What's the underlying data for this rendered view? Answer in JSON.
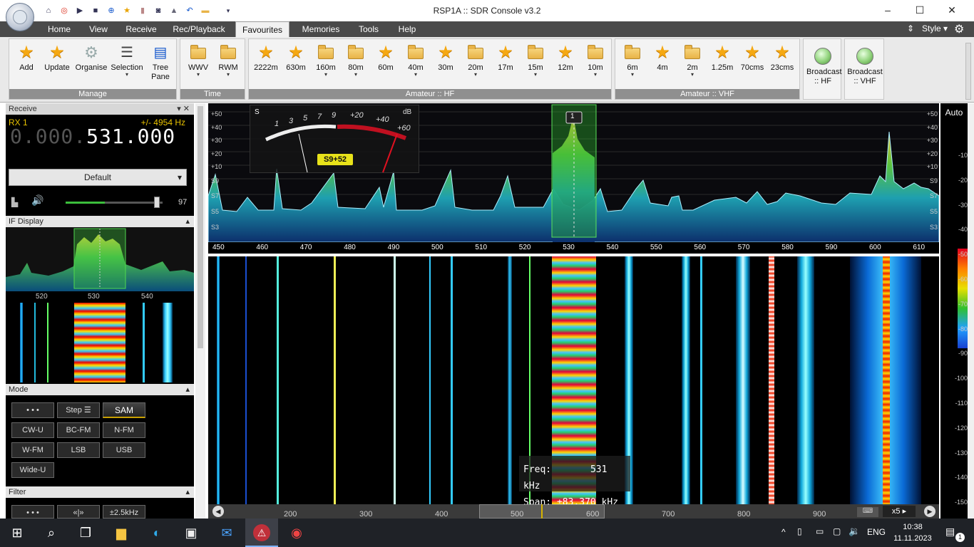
{
  "window": {
    "title": "RSP1A :: SDR Console v3.2",
    "controls": [
      "–",
      "☐",
      "✕"
    ]
  },
  "ribbon": {
    "tabs": [
      "Home",
      "View",
      "Receive",
      "Rec/Playback",
      "Favourites",
      "Memories",
      "Tools",
      "Help"
    ],
    "active_tab": "Favourites",
    "style_label": "Style",
    "groups": {
      "manage": {
        "label": "Manage",
        "buttons": [
          "Add",
          "Update",
          "Organise",
          "Selection",
          "Tree Pane"
        ]
      },
      "time": {
        "label": "Time",
        "buttons": [
          "WWV",
          "RWM"
        ]
      },
      "amateur_hf": {
        "label": "Amateur :: HF",
        "buttons": [
          "2222m",
          "630m",
          "160m",
          "80m",
          "60m",
          "40m",
          "30m",
          "20m",
          "17m",
          "15m",
          "12m",
          "10m"
        ]
      },
      "amateur_vhf": {
        "label": "Amateur :: VHF",
        "buttons": [
          "6m",
          "4m",
          "2m",
          "1.25m",
          "70cms",
          "23cms"
        ]
      },
      "broadcast": [
        "Broadcast :: HF",
        "Broadcast :: VHF"
      ]
    }
  },
  "receive_panel": {
    "header": "Receive",
    "rx_label": "RX 1",
    "offset": "+/- 4954 Hz",
    "freq_dim": "0.000.",
    "freq_main": "531.000",
    "preset": "Default",
    "volume": 97,
    "volume_label": "97"
  },
  "if_display": {
    "header": "IF Display",
    "ticks": [
      "520",
      "530",
      "540"
    ]
  },
  "mode_panel": {
    "header": "Mode",
    "buttons": [
      "• • •",
      "Step ☰",
      "SAM",
      "CW-U",
      "BC-FM",
      "N-FM",
      "W-FM",
      "LSB",
      "USB",
      "Wide-U"
    ],
    "selected": "SAM"
  },
  "filter_panel": {
    "header": "Filter",
    "buttons": [
      "• • •",
      "«|»",
      "±2.5kHz"
    ]
  },
  "spectrum": {
    "left_scale": [
      "+50",
      "+40",
      "+30",
      "+20",
      "+10",
      "S9",
      "S7",
      "S5",
      "S3"
    ],
    "right_scale": [
      "+50",
      "+40",
      "+30",
      "+20",
      "+10",
      "S9",
      "S7",
      "S5",
      "S3"
    ],
    "smeter_labels": [
      "S",
      "1",
      "3",
      "5",
      "7",
      "9",
      "+20",
      "+40",
      "+60",
      "dB"
    ],
    "smeter_reading": "S9+52",
    "marker": "1",
    "freq_ticks": [
      "450",
      "460",
      "470",
      "480",
      "490",
      "500",
      "510",
      "520",
      "530",
      "540",
      "550",
      "560",
      "570",
      "580",
      "590",
      "600",
      "610"
    ]
  },
  "waterfall": {
    "info_freq_label": "Freq:",
    "info_freq_value": "531 kHz",
    "info_span_label": "Span:",
    "info_span_value": "±83.370 kHz",
    "overview_ticks": [
      "200",
      "300",
      "400",
      "500",
      "600",
      "700",
      "800",
      "900"
    ],
    "zoom": "x5"
  },
  "right_scale": {
    "auto_label": "Auto",
    "values": [
      "-10",
      "-20",
      "-30",
      "-40",
      "-50",
      "-60",
      "-70",
      "-80",
      "-90",
      "-100",
      "-110",
      "-120",
      "-130",
      "-140",
      "-150"
    ]
  },
  "taskbar": {
    "lang": "ENG",
    "time": "10:38",
    "date": "11.11.2023",
    "notification_count": "1"
  },
  "colors": {
    "ribbon_dark": "#4a4a4a",
    "spectrum_bg": "#0a0a0e",
    "accent_green": "#2fb82f",
    "smeter_red": "#c01020"
  }
}
